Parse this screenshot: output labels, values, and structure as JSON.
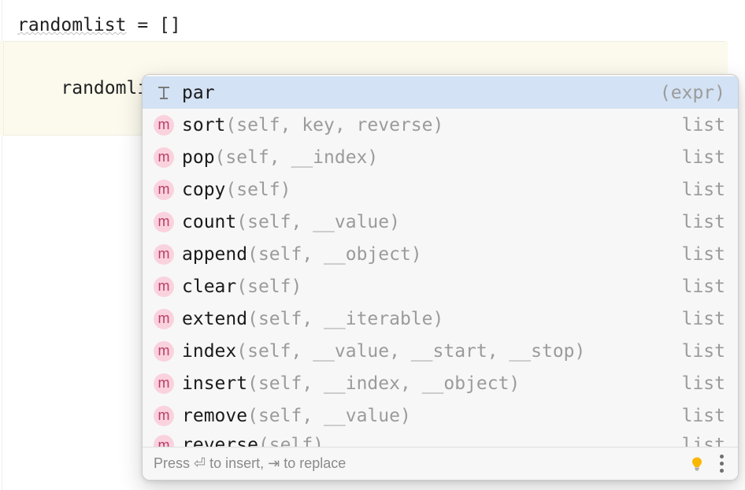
{
  "code": {
    "line1_var": "randomlist",
    "line1_rest": " = []",
    "line2": "randomlist."
  },
  "popup": {
    "items": [
      {
        "iconType": "par",
        "iconLabel": "",
        "name": "par",
        "params": "",
        "right": "(expr)"
      },
      {
        "iconType": "m",
        "iconLabel": "m",
        "name": "sort",
        "params": "(self, key, reverse)",
        "right": "list"
      },
      {
        "iconType": "m",
        "iconLabel": "m",
        "name": "pop",
        "params": "(self, __index)",
        "right": "list"
      },
      {
        "iconType": "m",
        "iconLabel": "m",
        "name": "copy",
        "params": "(self)",
        "right": "list"
      },
      {
        "iconType": "m",
        "iconLabel": "m",
        "name": "count",
        "params": "(self, __value)",
        "right": "list"
      },
      {
        "iconType": "m",
        "iconLabel": "m",
        "name": "append",
        "params": "(self, __object)",
        "right": "list"
      },
      {
        "iconType": "m",
        "iconLabel": "m",
        "name": "clear",
        "params": "(self)",
        "right": "list"
      },
      {
        "iconType": "m",
        "iconLabel": "m",
        "name": "extend",
        "params": "(self, __iterable)",
        "right": "list"
      },
      {
        "iconType": "m",
        "iconLabel": "m",
        "name": "index",
        "params": "(self, __value, __start, __stop)",
        "right": "list"
      },
      {
        "iconType": "m",
        "iconLabel": "m",
        "name": "insert",
        "params": "(self, __index, __object)",
        "right": "list"
      },
      {
        "iconType": "m",
        "iconLabel": "m",
        "name": "remove",
        "params": "(self, __value)",
        "right": "list"
      },
      {
        "iconType": "m",
        "iconLabel": "m",
        "name": "reverse",
        "params": "(self)",
        "right": "list"
      }
    ],
    "footerHint": "Press ⏎ to insert, ⇥ to replace"
  }
}
